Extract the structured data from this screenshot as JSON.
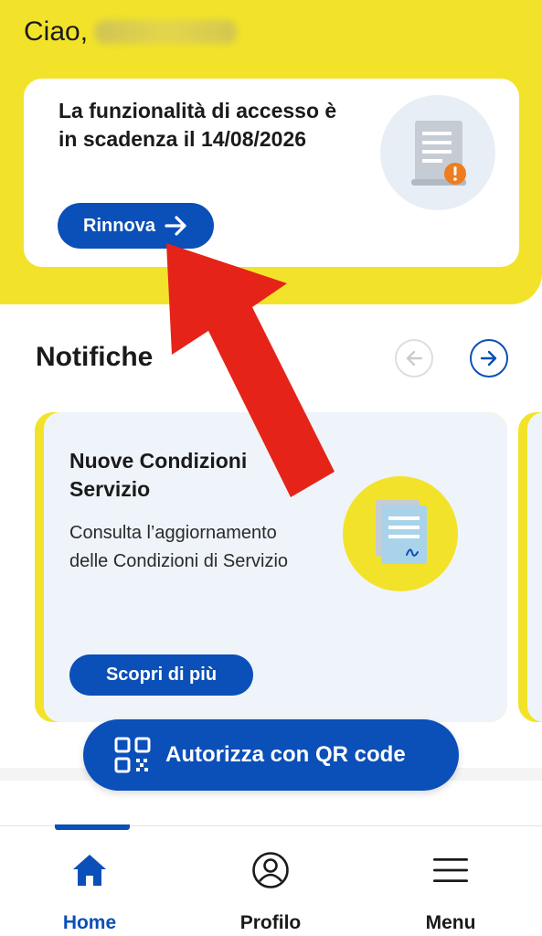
{
  "header": {
    "greeting": "Ciao,"
  },
  "access_card": {
    "message": "La funzionalità di accesso è in scadenza il 14/08/2026",
    "renew_label": "Rinnova",
    "illustration_icon": "document-warning-icon"
  },
  "notifications": {
    "title": "Notifiche",
    "prev_icon": "arrow-left-icon",
    "next_icon": "arrow-right-icon",
    "card": {
      "heading": "Nuove Condizioni Servizio",
      "description": "Consulta l’aggiornamento delle Condizioni di Servizio",
      "button_label": "Scopri di più",
      "illustration_icon": "signed-document-icon"
    }
  },
  "qr_button": {
    "label": "Autorizza con QR code",
    "icon": "qr-code-icon"
  },
  "bottom_nav": {
    "items": [
      {
        "label": "Home",
        "icon": "home-icon"
      },
      {
        "label": "Profilo",
        "icon": "user-circle-icon"
      },
      {
        "label": "Menu",
        "icon": "hamburger-menu-icon"
      }
    ]
  },
  "colors": {
    "brand_yellow": "#f2e32a",
    "brand_blue": "#0b4fb8",
    "card_bg": "#eff4fa",
    "annotation_red": "#e02020"
  }
}
